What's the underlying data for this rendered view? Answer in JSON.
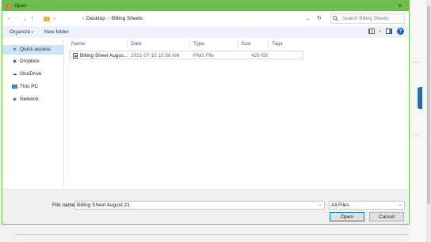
{
  "window": {
    "title": "Open",
    "close_glyph": "×"
  },
  "nav": {
    "back_glyph": "←",
    "forward_glyph": "→",
    "recent_glyph": "⌄",
    "up_glyph": "↑"
  },
  "address": {
    "crumbs": [
      "Desktop",
      "Billing Sheets"
    ],
    "sep_glyph": "›",
    "dropdown_glyph": "⌄",
    "refresh_glyph": "↻"
  },
  "search": {
    "placeholder": "Search Billing Sheets",
    "icon": "search-icon"
  },
  "toolbar": {
    "organize": "Organize",
    "new_folder": "New folder",
    "dropdown_glyph": "▾",
    "help_glyph": "?"
  },
  "sidebar": {
    "items": [
      {
        "label": "Quick access",
        "icon": "star-icon"
      },
      {
        "label": "Dropbox",
        "icon": "dropbox-icon"
      },
      {
        "label": "OneDrive",
        "icon": "cloud-icon"
      },
      {
        "label": "This PC",
        "icon": "computer-icon"
      },
      {
        "label": "Network",
        "icon": "network-icon"
      }
    ]
  },
  "filelist": {
    "columns": [
      "Name",
      "Date",
      "Type",
      "Size",
      "Tags"
    ],
    "rows": [
      {
        "name": "Billing Sheet Augus...",
        "date": "2021-07-15 10:58 AM",
        "type": "PNG File",
        "size": "429 KB",
        "tags": ""
      }
    ]
  },
  "footer": {
    "file_name_label": "File name:",
    "file_name_value": "Billing Sheet August 21",
    "file_type": "All Files",
    "open_label": "Open",
    "cancel_label": "Cancel"
  },
  "colors": {
    "titlebar": "#6cbf4a",
    "selection": "#cce4f7",
    "accent": "#0078d7"
  }
}
